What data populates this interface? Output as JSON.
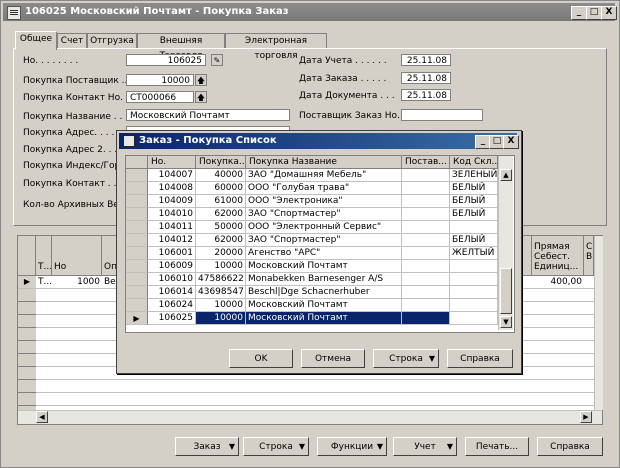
{
  "window": {
    "title": "106025 Московский Почтамт - Покупка Заказ",
    "min_label": "_",
    "max_label": "□",
    "close_label": "X"
  },
  "tabs": [
    "Общее",
    "Счет",
    "Отгрузка",
    "Внешняя Тэрговля",
    "Электронная торговля"
  ],
  "form": {
    "no_label": "Но. . . . . . . .",
    "no_value": "106025",
    "vendor_no_label": "Покупка Поставщик ...",
    "vendor_no_value": "10000",
    "contact_no_label": "Покупка Контакт Но. .",
    "contact_no_value": "CT000066",
    "name_label": "Покупка Название . .",
    "name_value": "Московский Почтамт",
    "address_label": "Покупка Адрес. . . .",
    "address2_label": "Покупка Адрес 2. . .",
    "postcode_label": "Покупка Индекс/Город",
    "contact_label": "Покупка Контакт . .",
    "archived_label": "Кол-во Архивных Ве...",
    "posting_date_label": "Дата Учета . . . . . .",
    "posting_date_value": "25.11.08",
    "order_date_label": "Дата Заказа . . . . .",
    "order_date_value": "25.11.08",
    "document_date_label": "Дата Документа . . .",
    "document_date_value": "25.11.08",
    "vendor_order_label": "Поставщик Заказ Но."
  },
  "grid": {
    "headers": [
      "Т...",
      "Но",
      "Оп",
      "Прямая Себест. Единиц...",
      "С В"
    ],
    "row": {
      "type": "Т...",
      "no": "1000",
      "desc": "Ве",
      "cost": "400,00"
    }
  },
  "bottom_buttons": [
    {
      "label": "Заказ",
      "dropdown": true
    },
    {
      "label": "Строка",
      "dropdown": true
    },
    {
      "label": "Функции",
      "dropdown": true
    },
    {
      "label": "Учет",
      "dropdown": true
    },
    {
      "label": "Печать...",
      "dropdown": false
    },
    {
      "label": "Справка",
      "dropdown": false
    }
  ],
  "dialog": {
    "title": "Заказ - Покупка Список",
    "columns": [
      "Но.",
      "Покупка...",
      "Покупка Название",
      "Постав...",
      "Код Скл..."
    ],
    "rows": [
      {
        "no": "104007",
        "vendor": "40000",
        "name": "ЗАО \"Домашняя Мебель\"",
        "vendor2": "",
        "loc": "ЗЕЛЕНЫЙ"
      },
      {
        "no": "104008",
        "vendor": "60000",
        "name": "ООО \"Голубая трава\"",
        "vendor2": "",
        "loc": "БЕЛЫЙ"
      },
      {
        "no": "104009",
        "vendor": "61000",
        "name": "ООО \"Электроника\"",
        "vendor2": "",
        "loc": "БЕЛЫЙ"
      },
      {
        "no": "104010",
        "vendor": "62000",
        "name": "ЗАО \"Спортмастер\"",
        "vendor2": "",
        "loc": "БЕЛЫЙ"
      },
      {
        "no": "104011",
        "vendor": "50000",
        "name": "ООО \"Электронный Сервис\"",
        "vendor2": "",
        "loc": ""
      },
      {
        "no": "104012",
        "vendor": "62000",
        "name": "ЗАО \"Спортмастер\"",
        "vendor2": "",
        "loc": "БЕЛЫЙ"
      },
      {
        "no": "106001",
        "vendor": "20000",
        "name": "Агенство \"АРС\"",
        "vendor2": "",
        "loc": "ЖЕЛТЫЙ"
      },
      {
        "no": "106009",
        "vendor": "10000",
        "name": "Московский Почтамт",
        "vendor2": "",
        "loc": ""
      },
      {
        "no": "106010",
        "vendor": "47586622",
        "name": "Monabekken Barnesenger A/S",
        "vendor2": "",
        "loc": ""
      },
      {
        "no": "106014",
        "vendor": "43698547",
        "name": "Beschl|Dge Schacnerhuber",
        "vendor2": "",
        "loc": ""
      },
      {
        "no": "106024",
        "vendor": "10000",
        "name": "Московский Почтамт",
        "vendor2": "",
        "loc": ""
      },
      {
        "no": "106025",
        "vendor": "10000",
        "name": "Московский Почтамт",
        "vendor2": "",
        "loc": ""
      }
    ],
    "selected_index": 11,
    "buttons": {
      "ok": "OK",
      "cancel": "Отмена",
      "line": "Строка",
      "help": "Справка"
    }
  },
  "colors": {
    "dialog_title": "#0a246a",
    "selection": "#0a246a",
    "face": "#d4d0c8"
  }
}
